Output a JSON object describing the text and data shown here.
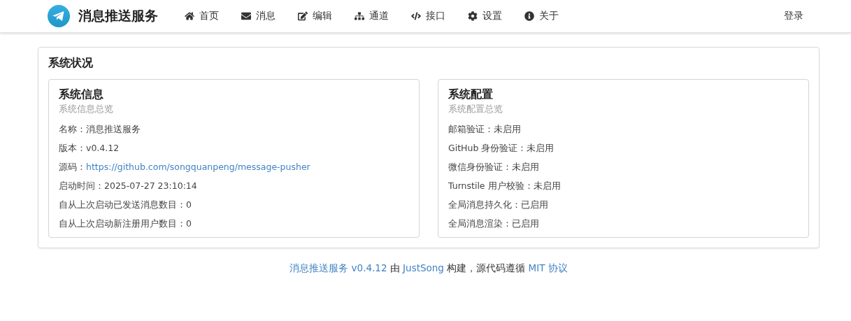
{
  "header": {
    "title": "消息推送服务",
    "nav": [
      {
        "kind": "home",
        "label": "首页"
      },
      {
        "kind": "envelope",
        "label": "消息"
      },
      {
        "kind": "edit",
        "label": "编辑"
      },
      {
        "kind": "sitemap",
        "label": "通道"
      },
      {
        "kind": "code",
        "label": "接口"
      },
      {
        "kind": "cog",
        "label": "设置"
      },
      {
        "kind": "info",
        "label": "关于"
      }
    ],
    "login": "登录"
  },
  "status": {
    "title": "系统状况",
    "cards": [
      {
        "title": "系统信息",
        "subtitle": "系统信息总览",
        "rows": [
          {
            "label": "名称：",
            "value": "消息推送服务",
            "kind": "text"
          },
          {
            "label": "版本：",
            "value": "v0.4.12",
            "kind": "text"
          },
          {
            "label": "源码：",
            "value": "https://github.com/songquanpeng/message-pusher",
            "kind": "link"
          },
          {
            "label": "启动时间：",
            "value": "2025-07-27 23:10:14",
            "kind": "text"
          },
          {
            "label": "自从上次启动已发送消息数目：",
            "value": "0",
            "kind": "text"
          },
          {
            "label": "自从上次启动新注册用户数目：",
            "value": "0",
            "kind": "text"
          }
        ]
      },
      {
        "title": "系统配置",
        "subtitle": "系统配置总览",
        "rows": [
          {
            "label": "邮箱验证：",
            "value": "未启用",
            "kind": "text"
          },
          {
            "label": "GitHub 身份验证：",
            "value": "未启用",
            "kind": "text"
          },
          {
            "label": "微信身份验证：",
            "value": "未启用",
            "kind": "text"
          },
          {
            "label": "Turnstile 用户校验：",
            "value": "未启用",
            "kind": "text"
          },
          {
            "label": "全局消息持久化：",
            "value": "已启用",
            "kind": "text"
          },
          {
            "label": "全局消息渲染：",
            "value": "已启用",
            "kind": "text"
          }
        ]
      }
    ]
  },
  "footer": [
    {
      "text": "消息推送服务 v0.4.12",
      "kind": "link"
    },
    {
      "text": " 由 ",
      "kind": "text"
    },
    {
      "text": "JustSong",
      "kind": "link"
    },
    {
      "text": " 构建，源代码遵循 ",
      "kind": "text"
    },
    {
      "text": "MIT 协议",
      "kind": "link"
    }
  ]
}
